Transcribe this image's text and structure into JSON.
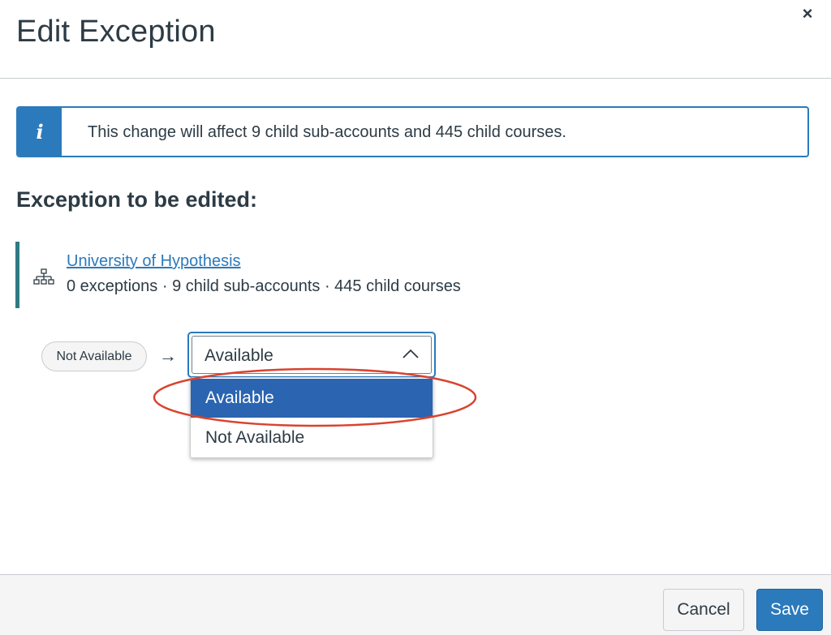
{
  "dialog": {
    "title": "Edit Exception",
    "close_label": "×"
  },
  "alert": {
    "icon": "info-icon",
    "icon_glyph": "i",
    "message": "This change will affect 9 child sub-accounts and 445 child courses.",
    "color": "#2b7abc"
  },
  "section": {
    "heading": "Exception to be edited:"
  },
  "account": {
    "icon": "hierarchy-icon",
    "name": "University of Hypothesis",
    "meta": "0 exceptions · 9 child sub-accounts · 445 child courses"
  },
  "change": {
    "from_label": "Not Available",
    "arrow": "→",
    "selected_value": "Available",
    "options": [
      {
        "label": "Available",
        "selected": true
      },
      {
        "label": "Not Available",
        "selected": false
      }
    ]
  },
  "footer": {
    "cancel_label": "Cancel",
    "save_label": "Save"
  },
  "colors": {
    "accent": "#2b7abc",
    "option_highlight": "#2b64b0",
    "annotation": "#d9432f",
    "account_bar": "#2e7b84"
  }
}
